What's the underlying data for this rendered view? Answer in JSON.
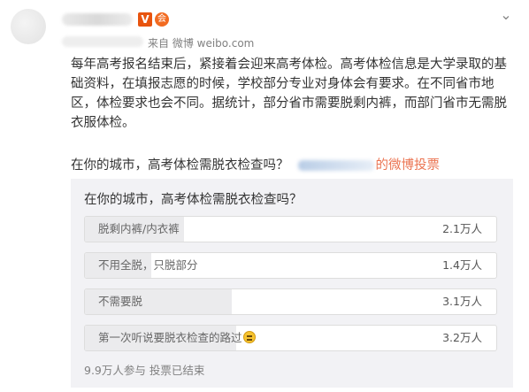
{
  "post": {
    "author": {
      "verified_badge": "V",
      "member_badge": "会"
    },
    "source": "来自 微博 weibo.com",
    "body": "每年高考报名结束后，紧接着会迎来高考体检。高考体检信息是大学录取的基础资料，在填报志愿的时候，学校部分专业对身体会有要求。在不同省市地区，体检要求也会不同。据统计，部分省市需要脱剩内裤，而部门省市无需脱衣服体检。",
    "question": "在你的城市，高考体检需脱衣检查吗？",
    "poll_link": "的微博投票"
  },
  "poll": {
    "title": "在你的城市，高考体检需脱衣检查吗？",
    "options": [
      {
        "label": "脱剩内裤/内衣裤",
        "count": "2.1万人",
        "share": 0.241
      },
      {
        "label": "不用全脱，只脱部分",
        "count": "1.4万人",
        "share": 0.161
      },
      {
        "label": "不需要脱",
        "count": "3.1万人",
        "share": 0.356
      },
      {
        "label": "第一次听说要脱衣检查的路过",
        "count": "3.2万人",
        "share": 0.368
      }
    ],
    "footer": "9.9万人参与 投票已结束"
  },
  "icons": {
    "more": "chevron-down-icon",
    "emoji": "grinning-face-icon"
  },
  "colors": {
    "verified": "#e8540f",
    "member": "#f26b21",
    "poll_link": "#eb7350",
    "poll_background": "#f2f2f5",
    "option_fill": "#ebebed"
  }
}
